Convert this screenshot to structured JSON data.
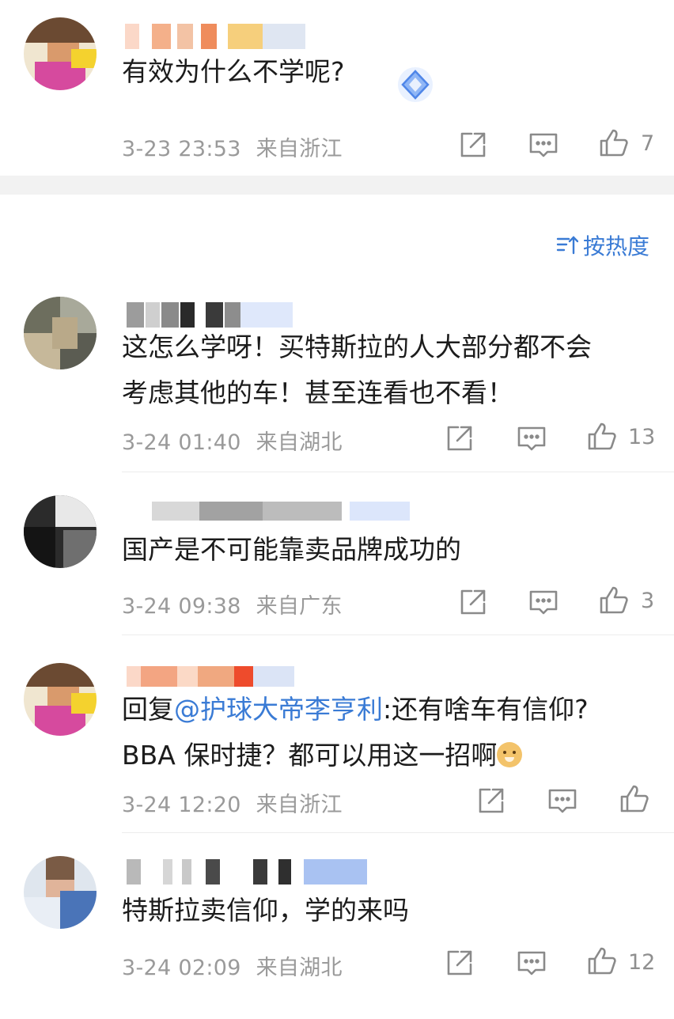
{
  "sort_label": "按热度",
  "comments": [
    {
      "text_lines": [
        "有效为什么不学呢?"
      ],
      "time": "3-23 23:53",
      "location": "来自浙江",
      "likes": "7"
    },
    {
      "text_lines": [
        "这怎么学呀！买特斯拉的人大部分都不会",
        "考虑其他的车！甚至连看也不看！"
      ],
      "time": "3-24 01:40",
      "location": "来自湖北",
      "likes": "13"
    },
    {
      "text_lines": [
        "国产是不可能靠卖品牌成功的"
      ],
      "time": "3-24 09:38",
      "location": "来自广东",
      "likes": "3"
    },
    {
      "reply_prefix": "回复",
      "mention": "@护球大帝李亨利",
      "reply_text": ":还有啥车有信仰?",
      "line2": "BBA 保时捷？都可以用这一招啊",
      "emoji": "doge",
      "time": "3-24 12:20",
      "location": "来自浙江",
      "likes": ""
    },
    {
      "text_lines": [
        "特斯拉卖信仰，学的来吗"
      ],
      "time": "3-24 02:09",
      "location": "来自湖北",
      "likes": "12"
    }
  ],
  "colors": {
    "link": "#3a7bd5",
    "meta": "#9a9a9a",
    "divider": "#f2f2f2"
  }
}
